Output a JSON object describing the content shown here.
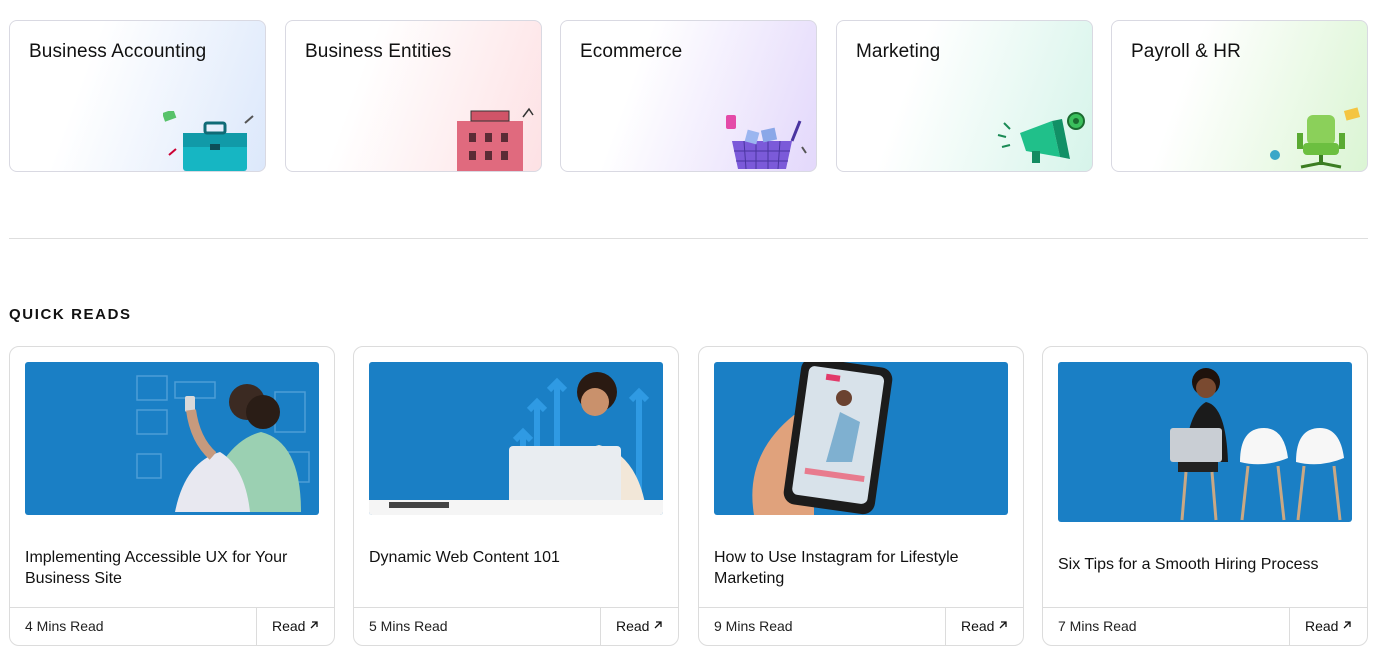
{
  "categories": [
    {
      "title": "Business Accounting",
      "icon": "briefcase-icon"
    },
    {
      "title": "Business Entities",
      "icon": "building-icon"
    },
    {
      "title": "Ecommerce",
      "icon": "shopping-cart-icon"
    },
    {
      "title": "Marketing",
      "icon": "megaphone-icon"
    },
    {
      "title": "Payroll & HR",
      "icon": "office-chair-icon"
    }
  ],
  "quick_reads": {
    "heading": "QUICK READS",
    "items": [
      {
        "title": "Implementing Accessible UX for Your Business Site",
        "mins": "4 Mins Read",
        "link": "Read"
      },
      {
        "title": "Dynamic Web Content 101",
        "mins": "5 Mins Read",
        "link": "Read"
      },
      {
        "title": "How to Use Instagram for Lifestyle Marketing",
        "mins": "9 Mins Read",
        "link": "Read"
      },
      {
        "title": "Six Tips for a Smooth Hiring Process",
        "mins": "7 Mins Read",
        "link": "Read"
      }
    ]
  },
  "colors": {
    "thumb_blue": "#1a7fc5",
    "accounting_tint": "#dde9fb",
    "entities_tint": "#fde3e6",
    "ecommerce_tint": "#e6dcfb",
    "marketing_tint": "#d9f5ec",
    "payroll_tint": "#dcf6d8"
  }
}
